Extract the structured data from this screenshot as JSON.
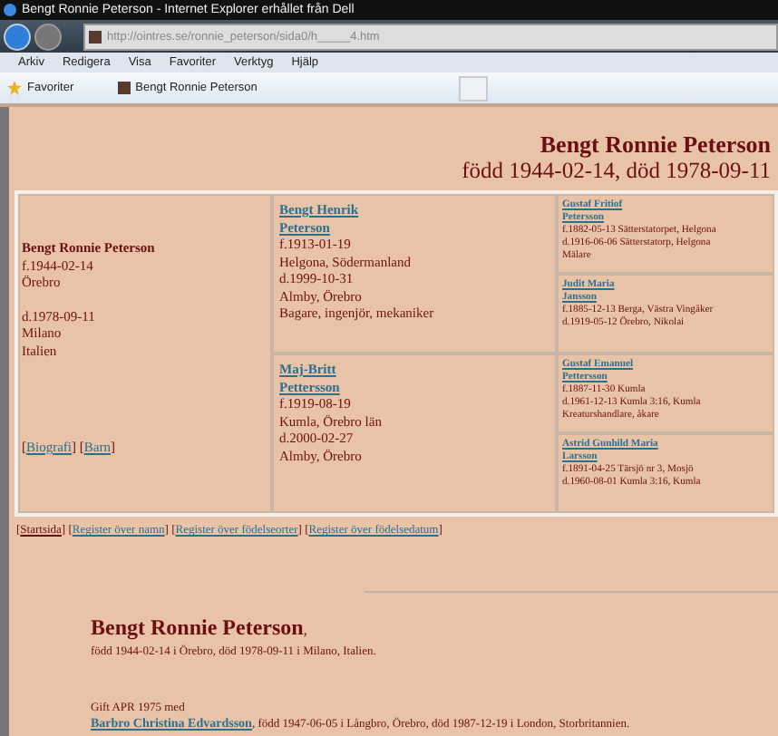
{
  "browser": {
    "title": "Bengt Ronnie Peterson - Internet Explorer erhållet från Dell",
    "address": "http://ointres.se/ronnie_peterson/sida0/h_____4.htm",
    "menu": [
      "Arkiv",
      "Redigera",
      "Visa",
      "Favoriter",
      "Verktyg",
      "Hjälp"
    ],
    "favorites": "Favoriter",
    "tab": "Bengt Ronnie Peterson"
  },
  "header": {
    "name": "Bengt Ronnie Peterson",
    "dates": "född 1944-02-14, död 1978-09-11"
  },
  "person": {
    "name": "Bengt Ronnie Peterson",
    "birth": [
      "f.1944-02-14",
      "Örebro"
    ],
    "death": [
      "d.1978-09-11",
      "Milano",
      "Italien"
    ],
    "links": [
      "Biografi",
      "Barn"
    ],
    "link_brackets": {
      "open": "[",
      "between": "] [",
      "close": "]"
    }
  },
  "parents": [
    {
      "name_lines": [
        "Bengt Henrik",
        "Peterson"
      ],
      "details": [
        "f.1913-01-19",
        "Helgona, Södermanland",
        "d.1999-10-31",
        "Almby, Örebro",
        "Bagare, ingenjör, mekaniker"
      ]
    },
    {
      "name_lines": [
        "Maj-Britt",
        "Pettersson"
      ],
      "details": [
        "f.1919-08-19",
        "Kumla, Örebro län",
        "d.2000-02-27",
        "Almby, Örebro"
      ]
    }
  ],
  "grandparents": [
    {
      "name_lines": [
        "Gustaf Fritiof",
        "Petersson"
      ],
      "details": [
        "f.1882-05-13 Sätterstatorpet, Helgona",
        "d.1916-06-06 Sätterstatorp, Helgona",
        "Mälare"
      ]
    },
    {
      "name_lines": [
        "Judit Maria",
        "Jansson"
      ],
      "details": [
        "f.1885-12-13 Berga, Västra Vingåker",
        "d.1919-05-12 Örebro, Nikolai"
      ]
    },
    {
      "name_lines": [
        "Gustaf Emanuel",
        "Pettersson"
      ],
      "details": [
        "f.1887-11-30 Kumla",
        "d.1961-12-13 Kumla 3:16, Kumla",
        "Kreaturshandlare, åkare"
      ]
    },
    {
      "name_lines": [
        "Astrid Gunhild Maria",
        "Larsson"
      ],
      "details": [
        "f.1891-04-25 Tärsjö nr 3, Mosjö",
        "d.1960-08-01 Kumla 3:16, Kumla"
      ]
    }
  ],
  "nav": [
    "Startsida",
    "Register över namn",
    "Register över födelseorter",
    "Register över födelsedatum"
  ],
  "nav_brackets": {
    "open": "[",
    "between": "] [",
    "close": "]"
  },
  "bio": {
    "name": "Bengt Ronnie Peterson",
    "comma": ",",
    "summary": "född 1944-02-14 i Örebro, död 1978-09-11 i Milano, Italien.",
    "marriage": "Gift APR 1975 med",
    "spouse": "Barbro Christina Edvardsson",
    "spouse_details": ", född 1947-06-05 i Långbro, Örebro, död 1987-12-19 i London, Storbritannien."
  }
}
